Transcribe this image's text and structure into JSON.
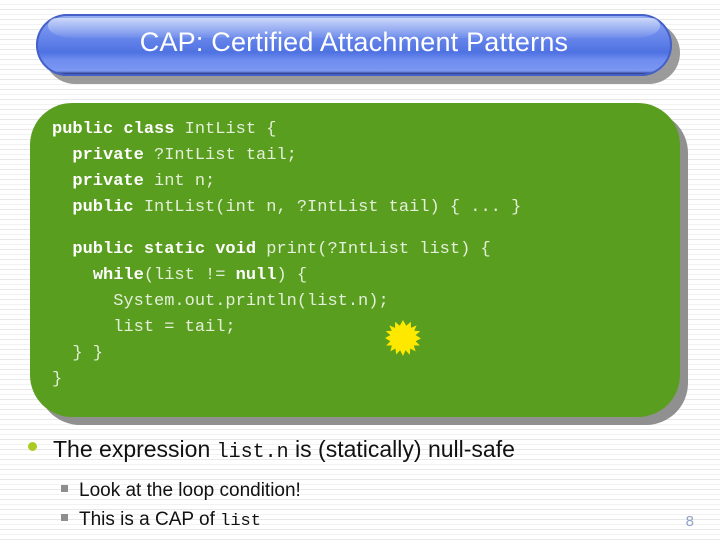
{
  "slide": {
    "title": "CAP: Certified Attachment Patterns",
    "page_number": "8",
    "colors": {
      "title_blue": "#5f7fe8",
      "code_green": "#5a9e20",
      "bullet_dot": "#aacc22",
      "sub_bullet_square": "#8e8e8e",
      "spark_yellow": "#ffe800",
      "page_number": "#8fa2c4"
    }
  },
  "code": {
    "language": "java",
    "lines": [
      {
        "indent": 0,
        "segments": [
          {
            "t": "public class ",
            "bold": true
          },
          {
            "t": "IntList {",
            "bold": false
          }
        ]
      },
      {
        "indent": 1,
        "segments": [
          {
            "t": "private ",
            "bold": true
          },
          {
            "t": "?IntList tail;",
            "bold": false
          }
        ]
      },
      {
        "indent": 1,
        "segments": [
          {
            "t": "private ",
            "bold": true
          },
          {
            "t": "int n;",
            "bold": false
          }
        ]
      },
      {
        "indent": 1,
        "segments": [
          {
            "t": "public ",
            "bold": true
          },
          {
            "t": "IntList(int n, ?IntList tail) { ... }",
            "bold": false
          }
        ]
      },
      {
        "indent": 0,
        "segments": []
      },
      {
        "indent": 1,
        "segments": [
          {
            "t": "public static void ",
            "bold": true
          },
          {
            "t": "print(?IntList list) {",
            "bold": false
          }
        ]
      },
      {
        "indent": 2,
        "segments": [
          {
            "t": "while",
            "bold": true
          },
          {
            "t": "(list != ",
            "bold": false
          },
          {
            "t": "null",
            "bold": true
          },
          {
            "t": ") {",
            "bold": false
          }
        ]
      },
      {
        "indent": 3,
        "segments": [
          {
            "t": "System.out.println(list.n);",
            "bold": false
          }
        ]
      },
      {
        "indent": 3,
        "segments": [
          {
            "t": "list = tail;",
            "bold": false
          }
        ]
      },
      {
        "indent": 1,
        "segments": [
          {
            "t": "} }",
            "bold": false
          }
        ]
      },
      {
        "indent": 0,
        "segments": [
          {
            "t": "}",
            "bold": false
          }
        ]
      }
    ],
    "full_text": "public class IntList {\n  private ?IntList tail;\n  private int n;\n  public IntList(int n, ?IntList tail) { ... }\n\n  public static void print(?IntList list) {\n    while(list != null) {\n      System.out.println(list.n);\n      list = tail;\n  } }\n}",
    "annotation": {
      "icon": "starburst-icon",
      "target_expression": "list.n"
    }
  },
  "bullets": {
    "main": {
      "prefix": "The expression ",
      "code": "list.n",
      "suffix": " is (statically) null-safe"
    },
    "sub": [
      {
        "prefix": "Look at the loop condition!",
        "code": "",
        "suffix": ""
      },
      {
        "prefix": "This is a CAP of ",
        "code": "list",
        "suffix": ""
      }
    ]
  }
}
